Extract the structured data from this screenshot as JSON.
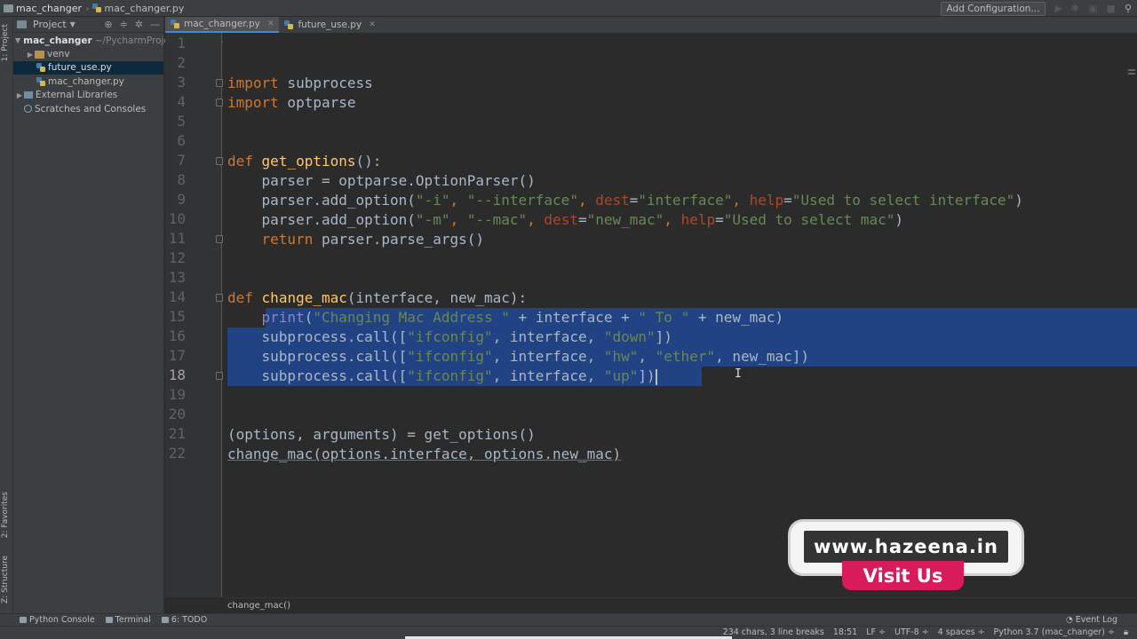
{
  "window": {
    "project_name": "mac_changer",
    "file_name": "mac_changer.py",
    "add_config_label": "Add Configuration..."
  },
  "left_strip": {
    "project_tab": "1: Project",
    "favorites_tab": "2: Favorites",
    "structure_tab": "Z: Structure"
  },
  "project_panel": {
    "title": "Project",
    "tree": {
      "root": "mac_changer",
      "root_path": "~/PycharmProjects/mac_changer",
      "venv": "venv",
      "file1": "future_use.py",
      "file2": "mac_changer.py",
      "external": "External Libraries",
      "scratches": "Scratches and Consoles"
    }
  },
  "tabs": {
    "tab1": "mac_changer.py",
    "tab2": "future_use.py"
  },
  "editor": {
    "line_numbers": [
      "1",
      "2",
      "3",
      "4",
      "5",
      "6",
      "7",
      "8",
      "9",
      "10",
      "11",
      "12",
      "13",
      "14",
      "15",
      "16",
      "17",
      "18",
      "19",
      "20",
      "21",
      "22"
    ],
    "current_line": "18",
    "breadcrumb": "change_mac()",
    "code": {
      "l3": {
        "kw": "import",
        "rest": " subprocess"
      },
      "l4": {
        "kw": "import",
        "rest": " optparse"
      },
      "l7": {
        "kw": "def",
        "fn": "get_options",
        "rest": "():"
      },
      "l8": "    parser = optparse.OptionParser()",
      "l9": {
        "a": "    parser.add_option(",
        "s1": "\"-i\"",
        "c1": ", ",
        "s2": "\"--interface\"",
        "c2": ", ",
        "p1": "dest",
        "e1": "=",
        "s3": "\"interface\"",
        "c3": ", ",
        "p2": "help",
        "e2": "=",
        "s4": "\"Used to select interface\"",
        "z": ")"
      },
      "l10": {
        "a": "    parser.add_option(",
        "s1": "\"-m\"",
        "c1": ", ",
        "s2": "\"--mac\"",
        "c2": ", ",
        "p1": "dest",
        "e1": "=",
        "s3": "\"new_mac\"",
        "c3": ", ",
        "p2": "help",
        "e2": "=",
        "s4": "\"Used to select mac\"",
        "z": ")"
      },
      "l11": {
        "indent": "    ",
        "kw": "return",
        "rest": " parser.parse_args()"
      },
      "l14": {
        "kw": "def",
        "fn": "change_mac",
        "rest": "(interface, new_mac):"
      },
      "l15": {
        "indent": "    ",
        "bi": "print",
        "a": "(",
        "s1": "\"Changing Mac Address \"",
        "b": " + interface + ",
        "s2": "\" To \"",
        "c": " + new_mac)"
      },
      "l16": {
        "a": "    subprocess.call([",
        "s1": "\"ifconfig\"",
        "b": ", interface, ",
        "s2": "\"down\"",
        "c": "])"
      },
      "l17": {
        "a": "    subprocess.call([",
        "s1": "\"ifconfig\"",
        "b": ", interface, ",
        "s2": "\"hw\"",
        "c1": ", ",
        "s3": "\"ether\"",
        "c": ", new_mac])"
      },
      "l18": {
        "a": "    subprocess.call([",
        "s1": "\"ifconfig\"",
        "b": ", interface, ",
        "s2": "\"up\"",
        "c": "])"
      },
      "l21": "(options, arguments) = get_options()",
      "l22": "change_mac(options.interface, options.new_mac)"
    }
  },
  "tool_windows": {
    "python_console": "Python Console",
    "terminal": "Terminal",
    "todo": "6: TODO",
    "event_log": "Event Log"
  },
  "status_bar": {
    "selection": "234 chars, 3 line breaks",
    "position": "18:51",
    "line_sep": "LF ÷",
    "encoding": "UTF-8 ÷",
    "indent": "4 spaces ÷",
    "interpreter": "Python 3.7 (mac_changer) ÷"
  },
  "overlay": {
    "url": "www.hazeena.in",
    "cta": "Visit Us"
  },
  "colors": {
    "keyword": "#cc7832",
    "function": "#ffc66d",
    "string": "#6a8759",
    "parameter": "#aa4926",
    "selection": "#214283",
    "badge_accent": "#d91b5c"
  }
}
